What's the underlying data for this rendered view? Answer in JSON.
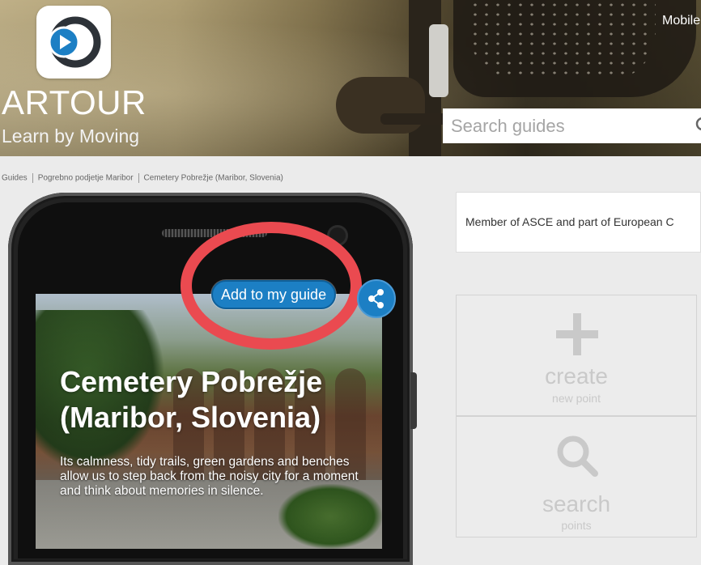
{
  "header": {
    "brand": "ARTOUR",
    "tagline": "Learn by Moving",
    "mobile_link": "Mobile",
    "search_placeholder": "Search guides",
    "logo_icon": "play-logo-icon"
  },
  "breadcrumb": [
    "Guides",
    "Pogrebno podjetje Maribor",
    "Cemetery Pobrežje (Maribor, Slovenia)"
  ],
  "guide": {
    "add_button": "Add to my guide",
    "title": "Cemetery Pobrežje (Maribor, Slovenia)",
    "description": "Its calmness, tidy trails, green gardens and benches allow us to step back from the noisy city for a moment and think about memories in silence."
  },
  "sidebar": {
    "member_text": "Member of ASCE and part of European C",
    "create": {
      "title": "create",
      "subtitle": "new point",
      "icon": "plus-icon"
    },
    "search": {
      "title": "search",
      "subtitle": "points",
      "icon": "magnifier-icon"
    }
  },
  "colors": {
    "accent_blue": "#1c7fc4",
    "annotation_red": "#ea4a50",
    "tile_text": "#c9c9c9"
  }
}
